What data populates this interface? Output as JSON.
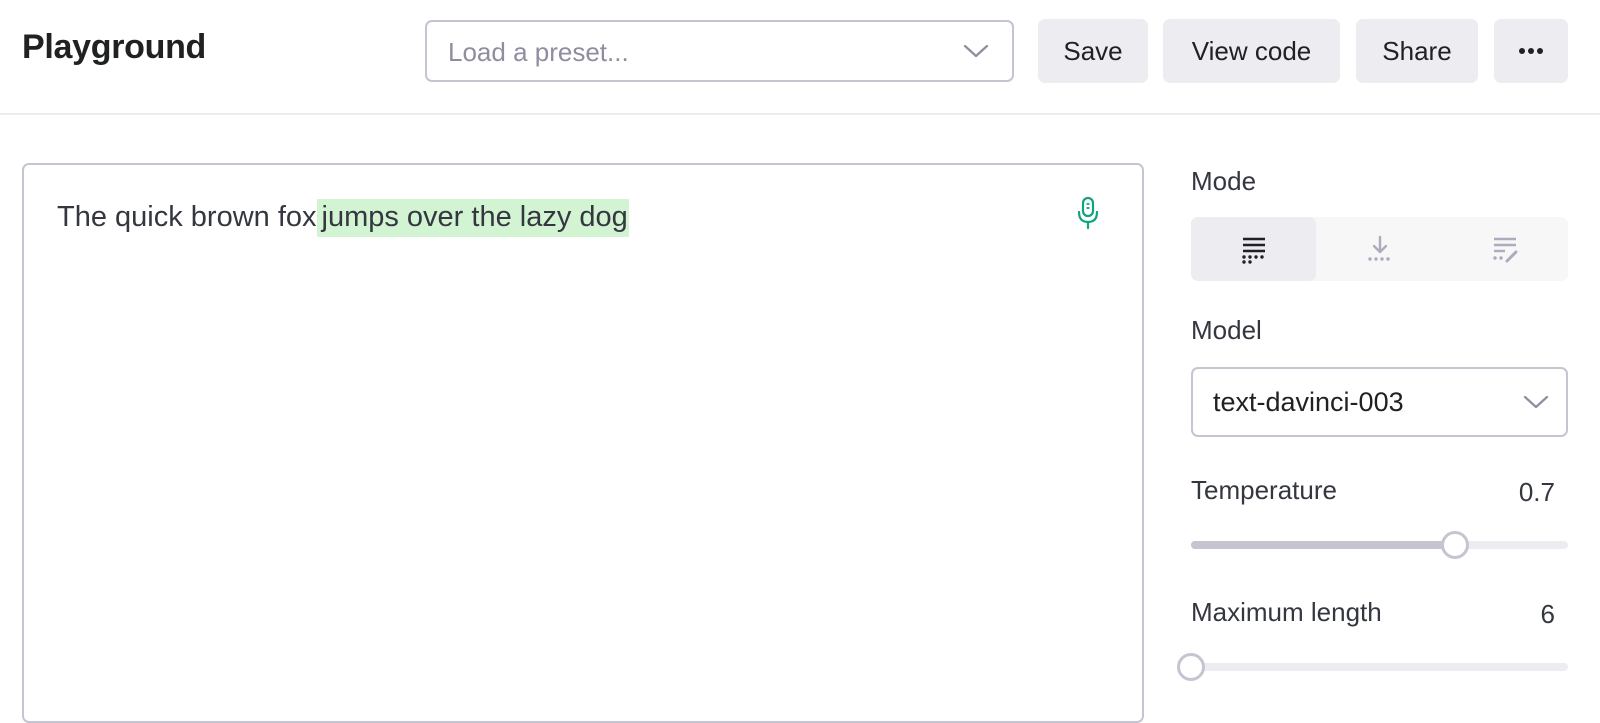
{
  "header": {
    "title": "Playground",
    "preset_placeholder": "Load a preset...",
    "save_label": "Save",
    "view_code_label": "View code",
    "share_label": "Share",
    "more_icon": "ellipsis-icon"
  },
  "editor": {
    "prompt_text": "The quick brown fox",
    "completion_text": "jumps over the lazy dog",
    "completion_highlight_color": "#d2f4d3",
    "mic_icon": "microphone-icon",
    "mic_color": "#10a37f"
  },
  "settings": {
    "mode": {
      "label": "Mode",
      "options": [
        {
          "name": "complete",
          "icon": "complete-mode-icon",
          "active": true
        },
        {
          "name": "insert",
          "icon": "insert-mode-icon",
          "active": false
        },
        {
          "name": "edit",
          "icon": "edit-mode-icon",
          "active": false
        }
      ]
    },
    "model": {
      "label": "Model",
      "value": "text-davinci-003"
    },
    "temperature": {
      "label": "Temperature",
      "value": "0.7",
      "fraction": 0.7
    },
    "max_length": {
      "label": "Maximum length",
      "value": "6",
      "fraction": 0.0
    }
  }
}
